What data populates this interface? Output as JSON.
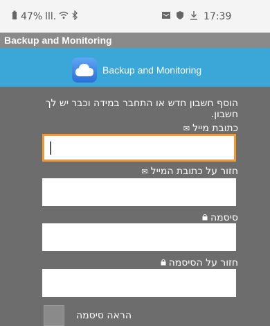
{
  "status_bar": {
    "battery": "47%",
    "signal": "lll.",
    "wifi_icon": "wifi-icon",
    "bluetooth_icon": "bluetooth-icon",
    "time": "17:39"
  },
  "app_bar": {
    "title": "Backup and Monitoring"
  },
  "banner": {
    "title": "Backup and Monitoring",
    "logo_icon": "cloud-icon"
  },
  "form": {
    "intro": "הוסף חשבון חדש או התחבר במידה וכבר יש לך חשבון.",
    "email_label": "כתובת מייל",
    "email_value": "",
    "confirm_email_label": "חזור על כתובת המייל",
    "confirm_email_value": "",
    "password_label": "סיסמה",
    "password_value": "",
    "confirm_password_label": "חזור על הסיסמה",
    "confirm_password_value": "",
    "show_password_label": "הראה סיסמה"
  },
  "colors": {
    "banner": "#3ba7d8",
    "content_bg": "#6d6d6d",
    "focus_border": "#f39a2e"
  }
}
